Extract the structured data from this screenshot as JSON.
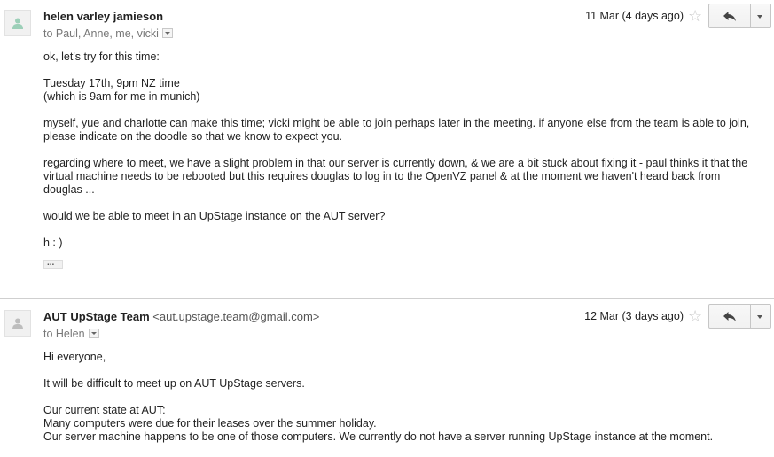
{
  "messages": [
    {
      "sender_name": "helen varley jamieson",
      "sender_email": "",
      "recipients": "to Paul, Anne, me, vicki",
      "date": "11 Mar (4 days ago)",
      "body": [
        "ok, let's try for this time:",
        "Tuesday 17th, 9pm NZ time\n(which is 9am for me in munich)",
        "myself, yue and charlotte can make this time; vicki might be able to join perhaps later in the meeting. if anyone else from the team is able to join, please indicate on the doodle so that we know to expect you.",
        "regarding where to meet, we have a slight problem in that our server is currently down, & we are a bit stuck about fixing it - paul thinks it that the virtual machine needs to be rebooted but this requires douglas to log in to the OpenVZ panel & at the moment we haven't heard back from douglas ...",
        "would we be able to meet in an UpStage instance on the AUT server?",
        "h : )"
      ],
      "show_trimmed": "..."
    },
    {
      "sender_name": "AUT UpStage Team",
      "sender_email": "<aut.upstage.team@gmail.com>",
      "recipients": "to Helen",
      "date": "12 Mar (3 days ago)",
      "body": [
        "Hi everyone,",
        "It will be difficult to meet up on AUT UpStage servers.",
        "Our current state at AUT:\nMany computers were due for their leases over the summer holiday.\nOur server machine happens to be one of those computers. We currently do not have a server running UpStage instance at the moment."
      ]
    }
  ],
  "icons": {
    "avatar": "person-icon",
    "star": "star-icon",
    "reply": "reply-icon",
    "more": "chevron-down-icon",
    "details": "chevron-down-icon"
  },
  "colors": {
    "avatar_person": "#9ccfb8",
    "avatar_person_2": "#bdbdbd",
    "star": "#c8c8c8",
    "meta_text": "#777777"
  }
}
